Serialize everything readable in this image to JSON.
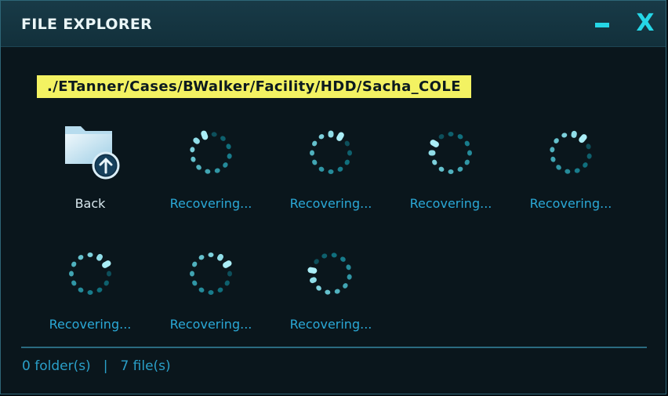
{
  "window": {
    "title": "FILE EXPLORER",
    "minimize_label": "",
    "close_label": "X"
  },
  "path": "./ETanner/Cases/BWalker/Facility/HDD/Sacha_COLE",
  "items": [
    {
      "label": "Back",
      "icon": "folder-up-icon"
    },
    {
      "label": "Recovering...",
      "icon": "loading-spinner-icon"
    },
    {
      "label": "Recovering...",
      "icon": "loading-spinner-icon"
    },
    {
      "label": "Recovering...",
      "icon": "loading-spinner-icon"
    },
    {
      "label": "Recovering...",
      "icon": "loading-spinner-icon"
    },
    {
      "label": "Recovering...",
      "icon": "loading-spinner-icon"
    },
    {
      "label": "Recovering...",
      "icon": "loading-spinner-icon"
    },
    {
      "label": "Recovering...",
      "icon": "loading-spinner-icon"
    }
  ],
  "status": {
    "folders": "0 folder(s)",
    "separator": "|",
    "files": "7 file(s)"
  },
  "colors": {
    "accent": "#25d6e6",
    "path_highlight": "#f3f262",
    "label_text": "#2aa8d6",
    "background": "#0a161c"
  }
}
